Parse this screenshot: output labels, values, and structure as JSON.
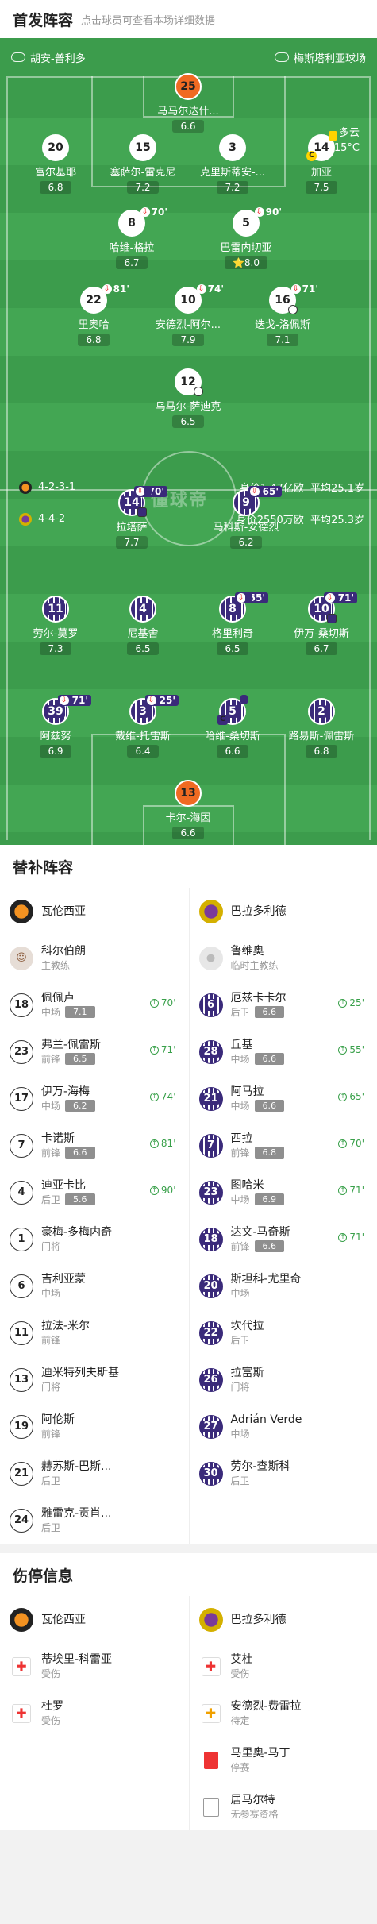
{
  "header": {
    "title": "首发阵容",
    "subtitle": "点击球员可查看本场详细数据"
  },
  "teams": {
    "home": "胡安-普利多",
    "away": "梅斯塔利亚球场"
  },
  "weather": {
    "desc": "多云",
    "temp": "15°C"
  },
  "home_lineup": [
    {
      "num": "25",
      "name": "马马尔达什...",
      "rating": "6.6",
      "gk": true
    },
    {
      "num": "20",
      "name": "富尔基耶",
      "rating": "6.8"
    },
    {
      "num": "15",
      "name": "塞萨尔-雷克尼",
      "rating": "7.2"
    },
    {
      "num": "3",
      "name": "克里斯蒂安-...",
      "rating": "7.2"
    },
    {
      "num": "14",
      "name": "加亚",
      "rating": "7.5",
      "card": true,
      "captain": "C"
    },
    {
      "num": "8",
      "name": "哈维-格拉",
      "rating": "6.7",
      "sub": "70'"
    },
    {
      "num": "5",
      "name": "巴雷内切亚",
      "rating": "8.0",
      "sub": "90'",
      "star": "⭐"
    },
    {
      "num": "22",
      "name": "里奥哈",
      "rating": "6.8",
      "sub": "81'"
    },
    {
      "num": "10",
      "name": "安德烈-阿尔...",
      "rating": "7.9",
      "sub": "74'"
    },
    {
      "num": "16",
      "name": "迭戈-洛佩斯",
      "rating": "7.1",
      "sub": "71'",
      "goal": true
    },
    {
      "num": "12",
      "name": "乌马尔-萨迪克",
      "rating": "6.5",
      "goal": true
    }
  ],
  "formation_info": {
    "home": {
      "formation": "4-2-3-1",
      "value": "身价1.47亿欧",
      "age": "平均25.1岁"
    },
    "away": {
      "formation": "4-4-2",
      "value": "身价2550万欧",
      "age": "平均25.3岁"
    },
    "watermark": "懂球帝"
  },
  "away_lineup": [
    {
      "num": "14",
      "name": "拉塔萨",
      "rating": "7.7",
      "sub": "70'",
      "card": true,
      "goal": true
    },
    {
      "num": "9",
      "name": "马科斯-安德烈",
      "rating": "6.2",
      "sub": "65'"
    },
    {
      "num": "11",
      "name": "劳尔-莫罗",
      "rating": "7.3"
    },
    {
      "num": "4",
      "name": "尼基舍",
      "rating": "6.5"
    },
    {
      "num": "8",
      "name": "格里利奇",
      "rating": "6.5",
      "sub": "55'",
      "card": true
    },
    {
      "num": "10",
      "name": "伊万-桑切斯",
      "rating": "6.7",
      "sub": "71'",
      "goal": true
    },
    {
      "num": "39",
      "name": "阿兹努",
      "rating": "6.9",
      "sub": "71'"
    },
    {
      "num": "3",
      "name": "戴维-托雷斯",
      "rating": "6.4",
      "sub": "25'"
    },
    {
      "num": "5",
      "name": "哈维-桑切斯",
      "rating": "6.6",
      "card": true,
      "captain": "C"
    },
    {
      "num": "2",
      "name": "路易斯-佩雷斯",
      "rating": "6.8"
    },
    {
      "num": "13",
      "name": "卡尔-海因",
      "rating": "6.6",
      "gk": true
    }
  ],
  "subs": {
    "title": "替补阵容",
    "home_team": "瓦伦西亚",
    "away_team": "巴拉多利德",
    "home_coach": {
      "name": "科尔伯朗",
      "role": "主教练"
    },
    "away_coach": {
      "name": "鲁维奥",
      "role": "临时主教练"
    },
    "home": [
      {
        "num": "18",
        "name": "佩佩卢",
        "pos": "中场",
        "rating": "7.1",
        "in": "70'"
      },
      {
        "num": "23",
        "name": "弗兰-佩雷斯",
        "pos": "前锋",
        "rating": "6.5",
        "in": "71'"
      },
      {
        "num": "17",
        "name": "伊万-海梅",
        "pos": "中场",
        "rating": "6.2",
        "in": "74'"
      },
      {
        "num": "7",
        "name": "卡诺斯",
        "pos": "前锋",
        "rating": "6.6",
        "in": "81'"
      },
      {
        "num": "4",
        "name": "迪亚卡比",
        "pos": "后卫",
        "rating": "5.6",
        "in": "90'"
      },
      {
        "num": "1",
        "name": "豪梅-多梅内奇",
        "pos": "门将"
      },
      {
        "num": "6",
        "name": "吉利亚蒙",
        "pos": "中场"
      },
      {
        "num": "11",
        "name": "拉法-米尔",
        "pos": "前锋"
      },
      {
        "num": "13",
        "name": "迪米特列夫斯基",
        "pos": "门将"
      },
      {
        "num": "19",
        "name": "阿伦斯",
        "pos": "前锋"
      },
      {
        "num": "21",
        "name": "赫苏斯-巴斯...",
        "pos": "后卫"
      },
      {
        "num": "24",
        "name": "雅雷克-贡肖...",
        "pos": "后卫"
      }
    ],
    "away": [
      {
        "num": "6",
        "name": "厄兹卡卡尔",
        "pos": "后卫",
        "rating": "6.6",
        "in": "25'"
      },
      {
        "num": "28",
        "name": "丘基",
        "pos": "中场",
        "rating": "6.6",
        "in": "55'"
      },
      {
        "num": "21",
        "name": "阿马拉",
        "pos": "中场",
        "rating": "6.6",
        "in": "65'"
      },
      {
        "num": "7",
        "name": "西拉",
        "pos": "前锋",
        "rating": "6.8",
        "in": "70'"
      },
      {
        "num": "23",
        "name": "图哈米",
        "pos": "中场",
        "rating": "6.9",
        "in": "71'"
      },
      {
        "num": "18",
        "name": "达文-马奇斯",
        "pos": "前锋",
        "rating": "6.6",
        "in": "71'"
      },
      {
        "num": "20",
        "name": "斯坦科-尤里奇",
        "pos": "中场"
      },
      {
        "num": "22",
        "name": "坎代拉",
        "pos": "后卫"
      },
      {
        "num": "26",
        "name": "拉富斯",
        "pos": "门将"
      },
      {
        "num": "27",
        "name": "Adrián Verde",
        "pos": "中场"
      },
      {
        "num": "30",
        "name": "劳尔-查斯科",
        "pos": "后卫"
      }
    ]
  },
  "injuries": {
    "title": "伤停信息",
    "home_team": "瓦伦西亚",
    "away_team": "巴拉多利德",
    "home": [
      {
        "name": "蒂埃里-科雷亚",
        "status": "受伤"
      },
      {
        "name": "杜罗",
        "status": "受伤"
      }
    ],
    "away": [
      {
        "name": "艾杜",
        "status": "受伤"
      },
      {
        "name": "安德烈-费雷拉",
        "status": "待定"
      },
      {
        "name": "马里奥-马丁",
        "status": "停赛"
      },
      {
        "name": "居马尔特",
        "status": "无参赛资格"
      }
    ]
  }
}
